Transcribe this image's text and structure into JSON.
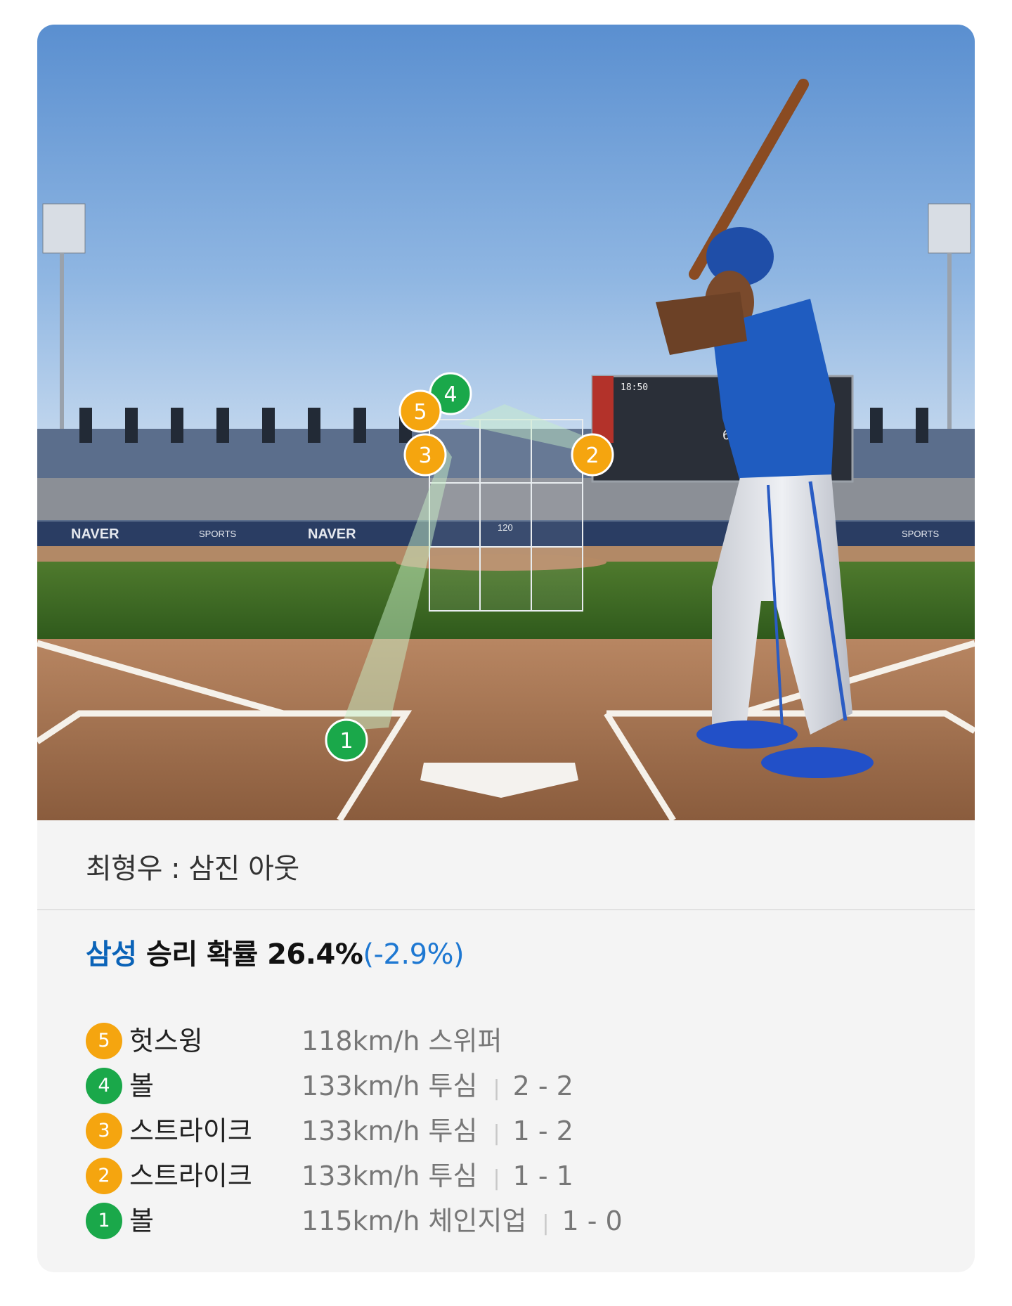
{
  "scene": {
    "scoreboard_clock": "18:50",
    "scoreboard_speed": "60",
    "banner_brand": "NAVER",
    "banner_sports": "SPORTS",
    "zone_speed": "120",
    "markers": [
      "1",
      "2",
      "3",
      "4",
      "5"
    ]
  },
  "result": {
    "text": "최형우 : 삼진 아웃"
  },
  "win_probability": {
    "team": "삼성",
    "label": " 승리 확률 26.4%",
    "delta": "(-2.9%)"
  },
  "pitches": [
    {
      "num": "5",
      "color": "orange",
      "result": "헛스윙",
      "speed": "118km/h",
      "type": "스위퍼",
      "count": ""
    },
    {
      "num": "4",
      "color": "green",
      "result": "볼",
      "speed": "133km/h",
      "type": "투심",
      "count": "2 - 2"
    },
    {
      "num": "3",
      "color": "orange",
      "result": "스트라이크",
      "speed": "133km/h",
      "type": "투심",
      "count": "1 - 2"
    },
    {
      "num": "2",
      "color": "orange",
      "result": "스트라이크",
      "speed": "133km/h",
      "type": "투심",
      "count": "1 - 1"
    },
    {
      "num": "1",
      "color": "green",
      "result": "볼",
      "speed": "115km/h",
      "type": "체인지업",
      "count": "1 - 0"
    }
  ]
}
